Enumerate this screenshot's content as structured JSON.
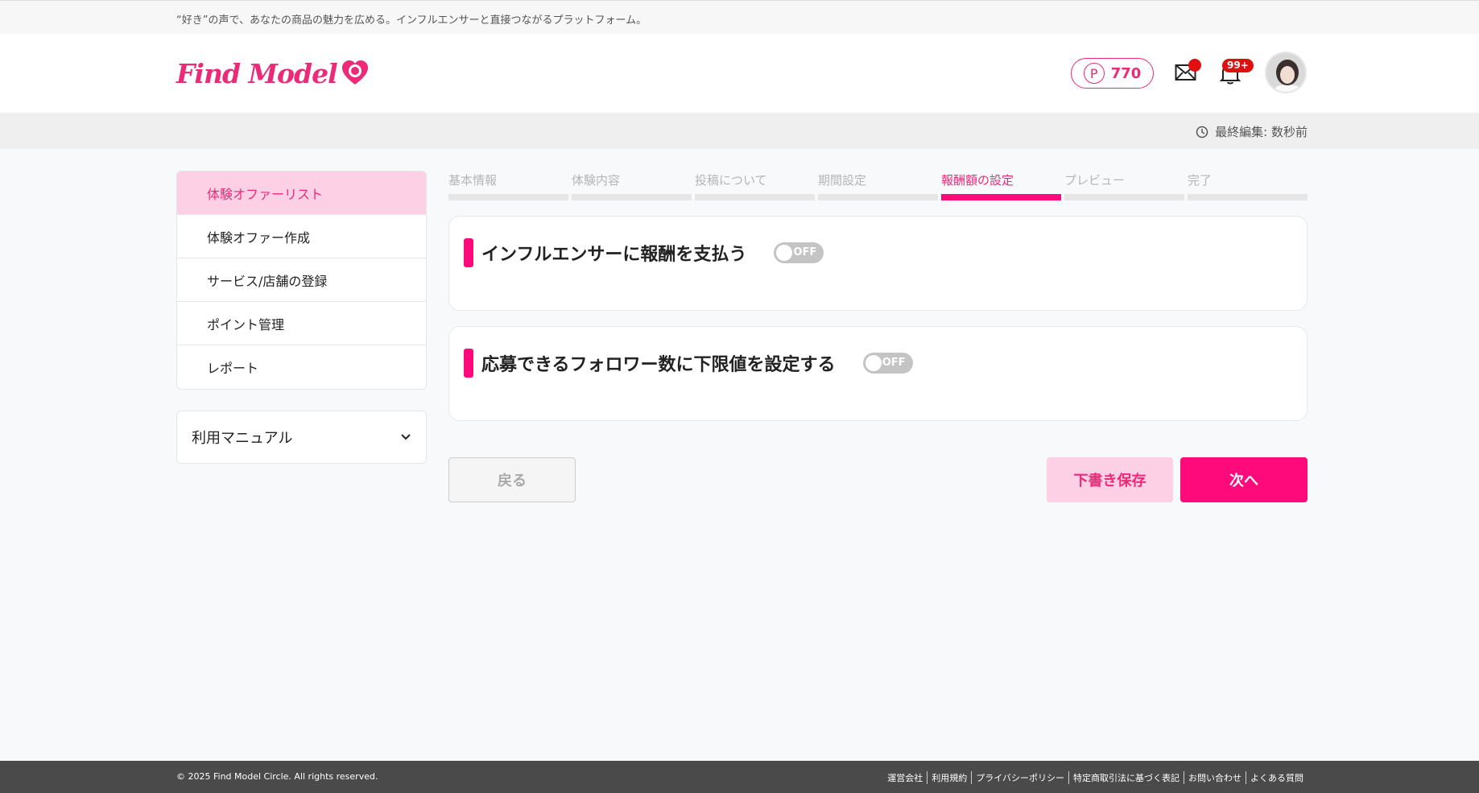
{
  "tagline": "“好き”の声で、あなたの商品の魅力を広める。インフルエンサーと直接つながるプラットフォーム。",
  "header": {
    "logo_text": "Find Model",
    "points": "770",
    "points_symbol": "P",
    "notifications_badge": "99+",
    "colors": {
      "brand": "#ec2a78",
      "accent": "#ff0a7a",
      "badge": "#e01010"
    }
  },
  "edit_status": {
    "text": "最終編集: 数秒前",
    "icon": "clock-icon"
  },
  "sidebar": {
    "items": [
      {
        "label": "体験オファーリスト",
        "active": true
      },
      {
        "label": "体験オファー作成",
        "active": false
      },
      {
        "label": "サービス/店舗の登録",
        "active": false
      },
      {
        "label": "ポイント管理",
        "active": false
      },
      {
        "label": "レポート",
        "active": false
      }
    ],
    "manual": {
      "label": "利用マニュアル",
      "icon": "chevron-down-icon"
    }
  },
  "steps": [
    {
      "label": "基本情報",
      "active": false
    },
    {
      "label": "体験内容",
      "active": false
    },
    {
      "label": "投稿について",
      "active": false
    },
    {
      "label": "期間設定",
      "active": false
    },
    {
      "label": "報酬額の設定",
      "active": true
    },
    {
      "label": "プレビュー",
      "active": false
    },
    {
      "label": "完了",
      "active": false
    }
  ],
  "cards": [
    {
      "title": "インフルエンサーに報酬を支払う",
      "toggle": "OFF"
    },
    {
      "title": "応募できるフォロワー数に下限値を設定する",
      "toggle": "OFF"
    }
  ],
  "buttons": {
    "back": "戻る",
    "draft": "下書き保存",
    "next": "次へ"
  },
  "footer": {
    "copyright": "© 2025 Find Model Circle. All rights reserved.",
    "links": [
      "運営会社",
      "利用規約",
      "プライバシーポリシー",
      "特定商取引法に基づく表記",
      "お問い合わせ",
      "よくある質問"
    ]
  }
}
